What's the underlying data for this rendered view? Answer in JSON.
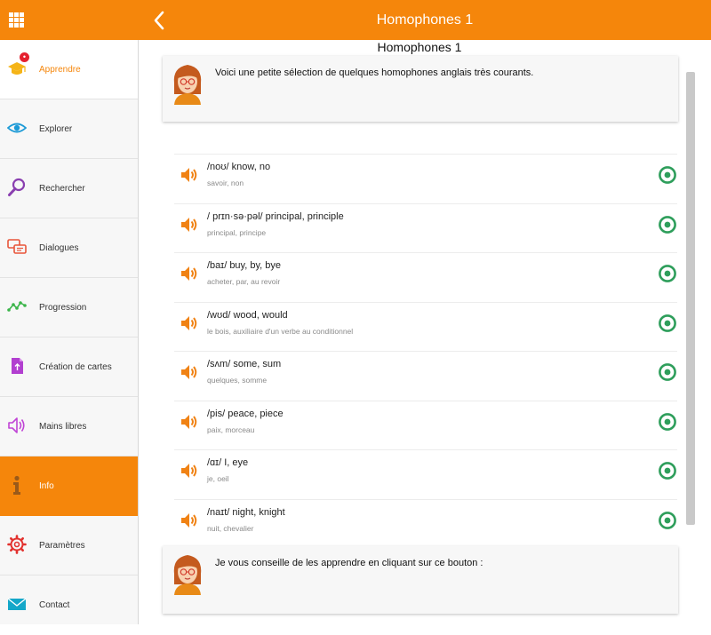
{
  "header": {
    "title": "Homophones 1",
    "menu_icon": "grid-icon",
    "back_icon": "chevron-left-icon",
    "color": "#f5860b"
  },
  "sidebar": {
    "items": [
      {
        "label": "Apprendre",
        "icon": "graduation-cap-icon",
        "badge": "•"
      },
      {
        "label": "Explorer",
        "icon": "eye-icon"
      },
      {
        "label": "Rechercher",
        "icon": "magnifier-icon"
      },
      {
        "label": "Dialogues",
        "icon": "chat-bubbles-icon"
      },
      {
        "label": "Progression",
        "icon": "progress-line-icon"
      },
      {
        "label": "Création de cartes",
        "icon": "card-create-icon"
      },
      {
        "label": "Mains libres",
        "icon": "speaker-icon"
      },
      {
        "label": "Info",
        "icon": "info-icon"
      },
      {
        "label": "Paramètres",
        "icon": "gear-icon"
      },
      {
        "label": "Contact",
        "icon": "envelope-icon"
      }
    ],
    "active_index": 7
  },
  "main": {
    "title": "Homophones 1",
    "intro": "Voici une petite sélection de quelques homophones anglais très courants.",
    "outro": "Je vous conseille de les apprendre en cliquant sur ce bouton :",
    "items": [
      {
        "phon": "/noʊ/ know, no",
        "trad": "savoir, non"
      },
      {
        "phon": "/ prɪn·sə·pəl/ principal, principle",
        "trad": "principal, principe"
      },
      {
        "phon": "/baɪ/ buy, by, bye",
        "trad": "acheter, par, au revoir"
      },
      {
        "phon": "/wʊd/ wood, would",
        "trad": "le bois, auxiliaire d'un verbe au conditionnel"
      },
      {
        "phon": "/sʌm/ some, sum",
        "trad": "quelques, somme"
      },
      {
        "phon": "/pis/ peace, piece",
        "trad": "paix, morceau"
      },
      {
        "phon": "/ɑɪ/ I, eye",
        "trad": "je, oeil"
      },
      {
        "phon": "/naɪt/ night, knight",
        "trad": "nuit, chevalier"
      }
    ]
  },
  "colors": {
    "accent": "#f5860b",
    "radio": "#2e9e5b",
    "badge": "#e5212f"
  }
}
